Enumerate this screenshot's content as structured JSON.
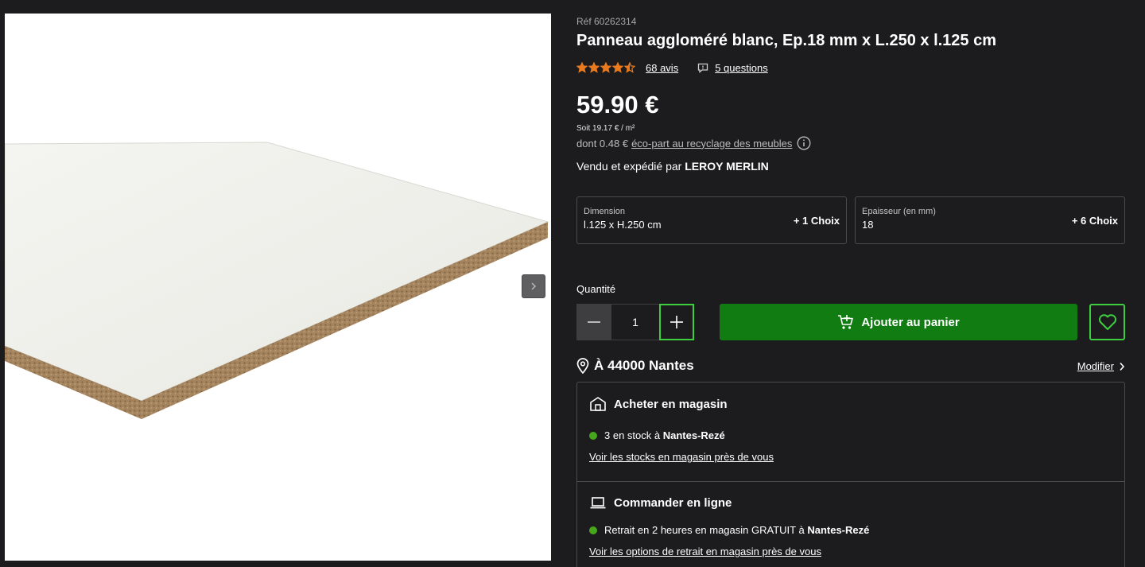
{
  "product": {
    "reference": "Réf 60262314",
    "title": "Panneau aggloméré blanc, Ep.18 mm x L.250 x l.125 cm",
    "rating": 4.5,
    "reviews_label": "68 avis",
    "questions_label": "5 questions",
    "price": "59.90 €",
    "unit_price": "Soit 19.17 € / m²",
    "eco_prefix": "dont 0.48 €",
    "eco_link": "éco-part au recyclage des meubles",
    "seller_prefix": "Vendu et expédié par",
    "seller_name": "LEROY MERLIN"
  },
  "selectors": [
    {
      "label": "Dimension",
      "value": "l.125 x H.250 cm",
      "choices": "+ 1 Choix"
    },
    {
      "label": "Epaisseur (en mm)",
      "value": "18",
      "choices": "+ 6 Choix"
    }
  ],
  "quantity": {
    "label": "Quantité",
    "value": "1"
  },
  "actions": {
    "add_to_cart": "Ajouter au panier"
  },
  "location": {
    "label": "À 44000 Nantes",
    "modify": "Modifier"
  },
  "store": {
    "title": "Acheter en magasin",
    "stock_prefix": "3 en stock à",
    "stock_store": "Nantes-Rezé",
    "link": "Voir les stocks en magasin près de vous"
  },
  "online": {
    "title": "Commander en ligne",
    "stock_prefix": "Retrait en 2 heures en magasin GRATUIT à",
    "stock_store": "Nantes-Rezé",
    "link": "Voir les options de retrait en magasin près de vous"
  },
  "colors": {
    "background": "#1c1c1e",
    "accent_green": "#117c12",
    "outline_green": "#3ecf3e",
    "star_orange": "#ea7a1e",
    "stock_dot": "#46a81a"
  },
  "icons": [
    "chevron-right-icon",
    "star-icon",
    "question-icon",
    "info-icon",
    "minus-icon",
    "plus-icon",
    "cart-icon",
    "heart-icon",
    "location-pin-icon",
    "store-icon",
    "laptop-icon"
  ]
}
